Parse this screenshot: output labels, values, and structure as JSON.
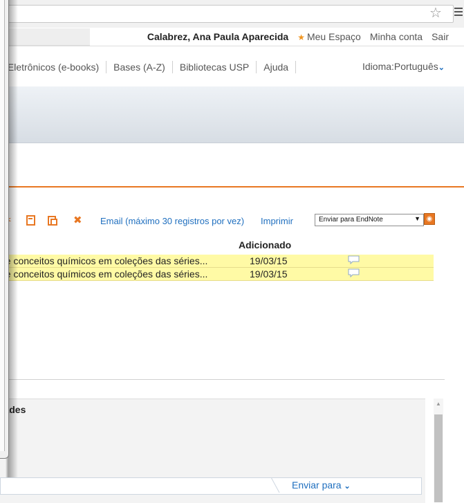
{
  "browser": {
    "star_icon": "star-outline-icon",
    "menu_icon": "hamburger-menu-icon"
  },
  "userbar": {
    "user_name": "Calabrez, Ana Paula Aparecida",
    "meu_espaco": "Meu Espaço",
    "minha_conta": "Minha conta",
    "sair": "Sair"
  },
  "nav": {
    "items": [
      {
        "label": "s Eletrônicos (e-books)"
      },
      {
        "label": "Bases (A-Z)"
      },
      {
        "label": "Bibliotecas USP"
      },
      {
        "label": "Ajuda"
      }
    ],
    "language_label": "Idioma:Português"
  },
  "toolbar": {
    "email_label": "Email (máximo 30 registros por vez)",
    "print_label": "Imprimir",
    "endnote_select": "Enviar para EndNote",
    "icons": [
      "scissors-icon",
      "copy-icon",
      "paste-icon",
      "delete-icon",
      "rss-icon"
    ]
  },
  "results": {
    "header_added": "Adicionado",
    "rows": [
      {
        "title": " de conceitos químicos em coleções das séries...",
        "date": "19/03/15"
      },
      {
        "title": " de conceitos químicos em coleções das séries...",
        "date": "19/03/15"
      }
    ]
  },
  "lower": {
    "panel_title": "rades",
    "enviar_label": "Enviar para"
  },
  "colors": {
    "accent": "#e87722",
    "link": "#1f6fbf",
    "highlight": "#fffaa5"
  }
}
